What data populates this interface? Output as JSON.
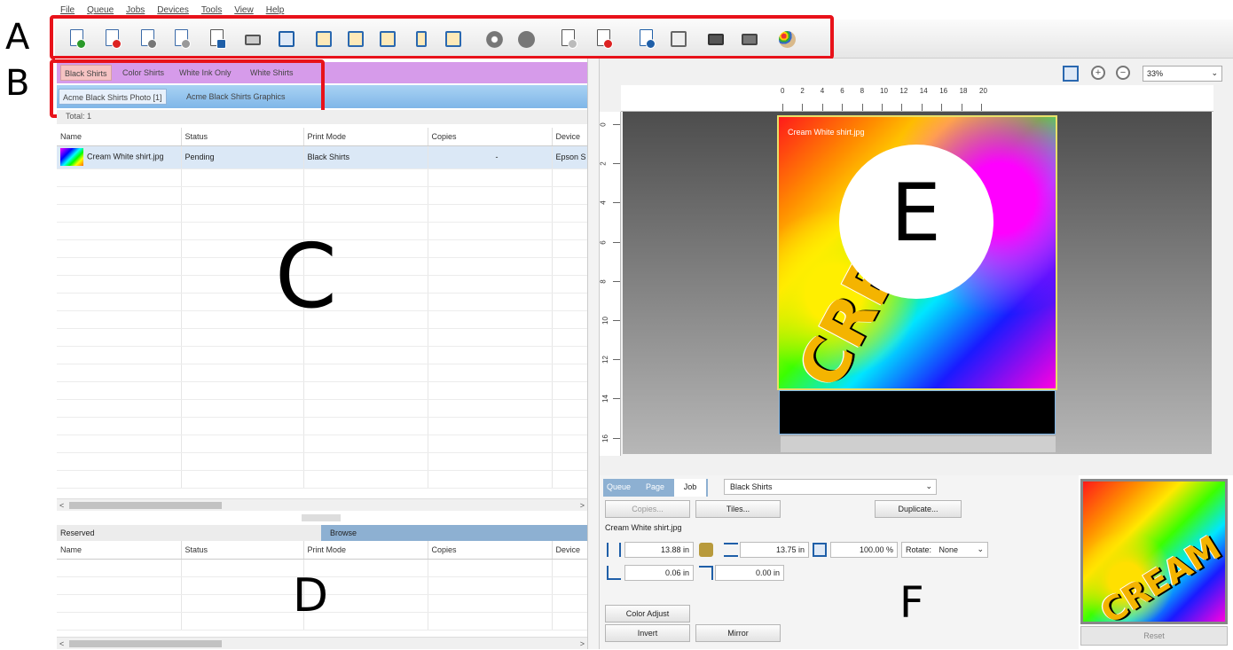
{
  "callouts": {
    "a": "A",
    "b": "B",
    "c": "C",
    "d": "D",
    "e": "E",
    "f": "F"
  },
  "menu": [
    "File",
    "Queue",
    "Jobs",
    "Devices",
    "Tools",
    "View",
    "Help"
  ],
  "toolbar_icons": [
    "add-job-icon",
    "remove-job-icon",
    "hold-job-icon",
    "release-job-icon",
    "send-to-device-icon",
    "print-icon",
    "preview-icon",
    "align-top-icon",
    "align-left-icon",
    "align-right-icon",
    "fit-height-icon",
    "fit-width-icon",
    "settings-icon",
    "cancel-icon",
    "move-up-icon",
    "delete-from-device-icon",
    "duplicate-icon",
    "properties-icon",
    "printer-setup-icon",
    "device-manager-icon",
    "color-palette-icon"
  ],
  "print_modes": {
    "tabs": [
      "Black Shirts",
      "Color Shirts",
      "White Ink Only",
      "White Shirts"
    ],
    "selected": "Black Shirts"
  },
  "queues": {
    "tabs": [
      "Acme Black Shirts Photo [1]",
      "Acme Black Shirts Graphics"
    ],
    "selected": "Acme Black Shirts Photo [1]"
  },
  "jobs_total_label": "Total: 1",
  "jobs_table": {
    "columns": [
      "Name",
      "Status",
      "Print Mode",
      "Copies",
      "Device"
    ],
    "rows": [
      {
        "name": "Cream White shirt.jpg",
        "status": "Pending",
        "mode": "Black Shirts",
        "copies": "-",
        "device": "Epson S"
      }
    ]
  },
  "lower_tabs": {
    "reserved": "Reserved",
    "browse": "Browse"
  },
  "reserved_table": {
    "columns": [
      "Name",
      "Status",
      "Print Mode",
      "Copies",
      "Device"
    ]
  },
  "zoom": "33%",
  "ruler_top": [
    "0",
    "2",
    "4",
    "6",
    "8",
    "10",
    "12",
    "14",
    "16",
    "18",
    "20"
  ],
  "ruler_left": [
    "0",
    "2",
    "4",
    "6",
    "8",
    "10",
    "12",
    "14",
    "16"
  ],
  "art": {
    "filename": "Cream White shirt.jpg",
    "text": "CREAM"
  },
  "job_panel": {
    "tabs": [
      "Queue",
      "Page",
      "Job"
    ],
    "selected_tab": "Job",
    "mode_select": "Black Shirts",
    "copies_label": "Copies...",
    "tiles_label": "Tiles...",
    "duplicate_label": "Duplicate...",
    "filename": "Cream White shirt.jpg",
    "width": "13.88 in",
    "height": "13.75 in",
    "scale": "100.00 %",
    "rotate_label": "Rotate:",
    "rotate_value": "None",
    "x_offset": "0.06 in",
    "y_offset": "0.00 in",
    "color_adjust": "Color Adjust",
    "invert": "Invert",
    "mirror": "Mirror"
  },
  "preview": {
    "reset": "Reset"
  },
  "colors": {
    "highlight": "#e8121a",
    "mode_tabs": "#d69bea",
    "queue_tabs": "#7fb6e8"
  }
}
